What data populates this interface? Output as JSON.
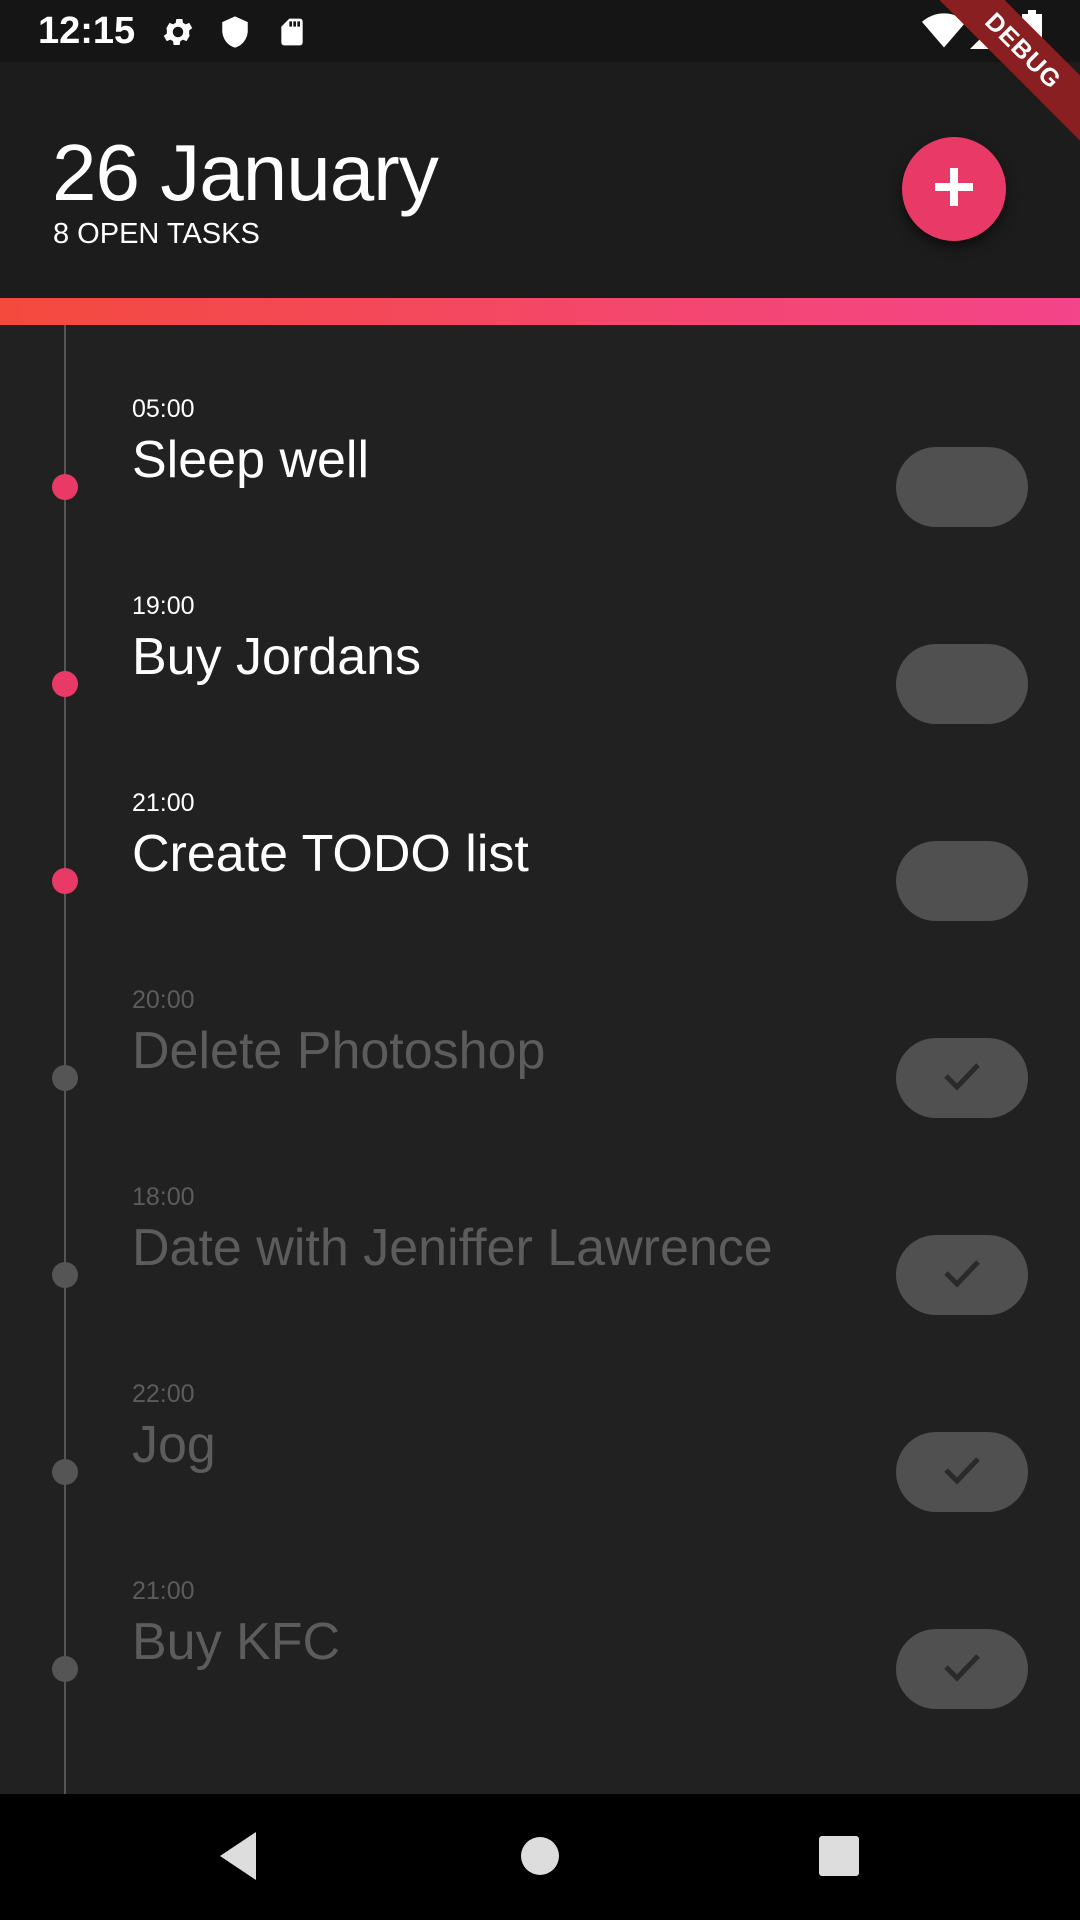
{
  "status_bar": {
    "time": "12:15",
    "icons": [
      "settings-icon",
      "shield-icon",
      "sd-card-icon",
      "wifi-icon",
      "signal-icon",
      "battery-icon"
    ]
  },
  "debug_banner": "DEBUG",
  "header": {
    "date": "26 January",
    "subtitle": "8 OPEN TASKS",
    "add_icon": "plus-icon"
  },
  "colors": {
    "accent": "#e93a67",
    "gradient_start": "#f44a3d",
    "gradient_end": "#f4448a",
    "background": "#212121",
    "done_text": "#5c5c5c",
    "toggle": "#505050"
  },
  "tasks": [
    {
      "time": "05:00",
      "title": "Sleep well",
      "done": false
    },
    {
      "time": "19:00",
      "title": "Buy Jordans",
      "done": false
    },
    {
      "time": "21:00",
      "title": "Create TODO list",
      "done": false
    },
    {
      "time": "20:00",
      "title": "Delete Photoshop",
      "done": true
    },
    {
      "time": "18:00",
      "title": "Date with Jeniffer Lawrence",
      "done": true
    },
    {
      "time": "22:00",
      "title": "Jog",
      "done": true
    },
    {
      "time": "21:00",
      "title": "Buy KFC",
      "done": true
    }
  ],
  "nav_bar": {
    "buttons": [
      "back-icon",
      "home-icon",
      "recents-icon"
    ]
  }
}
